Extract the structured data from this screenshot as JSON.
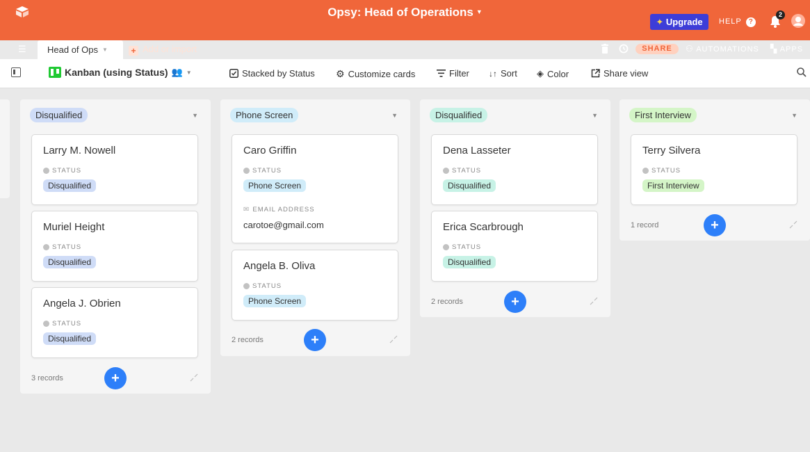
{
  "app": {
    "base_title": "Opsy: Head of Operations",
    "upgrade_label": "Upgrade",
    "help_label": "HELP",
    "notification_count": "2"
  },
  "tabs": {
    "active_label": "Head of Ops",
    "add_label": "Add or import"
  },
  "actions": {
    "share_label": "SHARE",
    "automations_label": "AUTOMATIONS",
    "apps_label": "APPS"
  },
  "toolbar": {
    "view_label": "Kanban (using Status)",
    "stacked_label": "Stacked by Status",
    "customize_label": "Customize cards",
    "filter_label": "Filter",
    "sort_label": "Sort",
    "color_label": "Color",
    "share_view_label": "Share view"
  },
  "colors": {
    "accent": "#f0663a",
    "disqualified_col": "#cfdcf7",
    "phone_screen": "#d0ecf9",
    "disqualified_teal": "#c7f2e6",
    "first_interview": "#d4f5c7",
    "add_button": "#2d7ff9"
  },
  "board": {
    "field_status_label": "STATUS",
    "field_email_label": "EMAIL ADDRESS",
    "columns": [
      {
        "title": "Disqualified",
        "footer": "3 records",
        "cards": [
          {
            "name": "Larry M. Nowell",
            "status": "Disqualified"
          },
          {
            "name": "Muriel Height",
            "status": "Disqualified"
          },
          {
            "name": "Angela J. Obrien",
            "status": "Disqualified"
          }
        ]
      },
      {
        "title": "Phone Screen",
        "footer": "2 records",
        "cards": [
          {
            "name": "Caro Griffin",
            "status": "Phone Screen",
            "email": "carotoe@gmail.com"
          },
          {
            "name": "Angela B. Oliva",
            "status": "Phone Screen"
          }
        ]
      },
      {
        "title": "Disqualified",
        "footer": "2 records",
        "cards": [
          {
            "name": "Dena Lasseter",
            "status": "Disqualified"
          },
          {
            "name": "Erica Scarbrough",
            "status": "Disqualified"
          }
        ]
      },
      {
        "title": "First Interview",
        "footer": "1 record",
        "cards": [
          {
            "name": "Terry Silvera",
            "status": "First Interview"
          }
        ]
      }
    ]
  }
}
